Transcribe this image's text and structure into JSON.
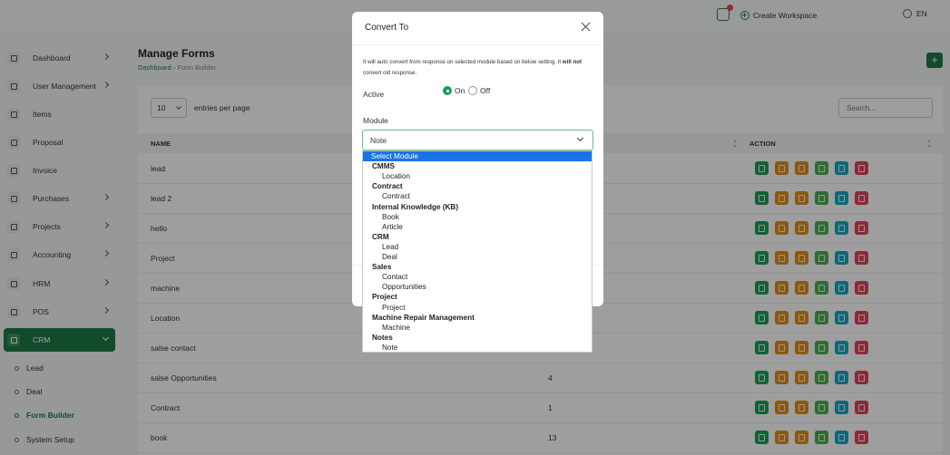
{
  "topbar": {
    "create_workspace": "Create Workspace",
    "lang": "EN"
  },
  "sidebar": {
    "items": [
      {
        "label": "Dashboard",
        "icon": "home-icon",
        "chevron": true
      },
      {
        "label": "User Management",
        "icon": "users-icon",
        "chevron": true
      },
      {
        "label": "Items",
        "icon": "cart-icon",
        "chevron": false
      },
      {
        "label": "Proposal",
        "icon": "proposal-icon",
        "chevron": false
      },
      {
        "label": "Invoice",
        "icon": "invoice-icon",
        "chevron": false
      },
      {
        "label": "Purchases",
        "icon": "purchases-icon",
        "chevron": true
      },
      {
        "label": "Projects",
        "icon": "projects-icon",
        "chevron": true
      },
      {
        "label": "Accounting",
        "icon": "accounting-icon",
        "chevron": true
      },
      {
        "label": "HRM",
        "icon": "hrm-icon",
        "chevron": true
      },
      {
        "label": "POS",
        "icon": "pos-icon",
        "chevron": true
      },
      {
        "label": "CRM",
        "icon": "crm-icon",
        "chevron": true
      }
    ],
    "sub_items": [
      "Lead",
      "Deal",
      "Form Builder",
      "System Setup"
    ]
  },
  "page": {
    "title": "Manage Forms",
    "breadcrumb": [
      "Dashboard",
      "Form Builder"
    ],
    "entries_value": "10",
    "entries_label": "entries per page",
    "search_placeholder": "Search..."
  },
  "table": {
    "headers": [
      "NAME",
      "ACTION"
    ],
    "rows": [
      {
        "name": "lead",
        "count": ""
      },
      {
        "name": "lead 2",
        "count": ""
      },
      {
        "name": "hello",
        "count": ""
      },
      {
        "name": "Project",
        "count": ""
      },
      {
        "name": "machine",
        "count": ""
      },
      {
        "name": "Location",
        "count": ""
      },
      {
        "name": "salse contact",
        "count": ""
      },
      {
        "name": "salse Opportunities",
        "count": "4"
      },
      {
        "name": "Contract",
        "count": "1"
      },
      {
        "name": "book",
        "count": "13"
      }
    ],
    "action_colors": [
      "#1e9d5a",
      "#e08e1a",
      "#e08e1a",
      "#4caf50",
      "#1aa6c4",
      "#e0445a"
    ]
  },
  "modal": {
    "title": "Convert To",
    "note_pre": "It will auto convert from response on selected module based on below setting. It ",
    "note_bold": "will not",
    "note_post": " convert old response.",
    "active_label": "Active",
    "on_label": "On",
    "off_label": "Off",
    "active_value": "On",
    "module_label": "Module",
    "module_value": "Note"
  },
  "dropdown": {
    "placeholder": "Select Module",
    "groups": [
      {
        "label": "CMMS",
        "options": [
          "Location"
        ]
      },
      {
        "label": "Contract",
        "options": [
          "Contract"
        ]
      },
      {
        "label": "Internal Knowledge (KB)",
        "options": [
          "Book",
          "Article"
        ]
      },
      {
        "label": "CRM",
        "options": [
          "Lead",
          "Deal"
        ]
      },
      {
        "label": "Sales",
        "options": [
          "Contact",
          "Opportunities"
        ]
      },
      {
        "label": "Project",
        "options": [
          "Project"
        ]
      },
      {
        "label": "Machine Repair Management",
        "options": [
          "Machine"
        ]
      },
      {
        "label": "Notes",
        "options": [
          "Note"
        ]
      }
    ]
  }
}
